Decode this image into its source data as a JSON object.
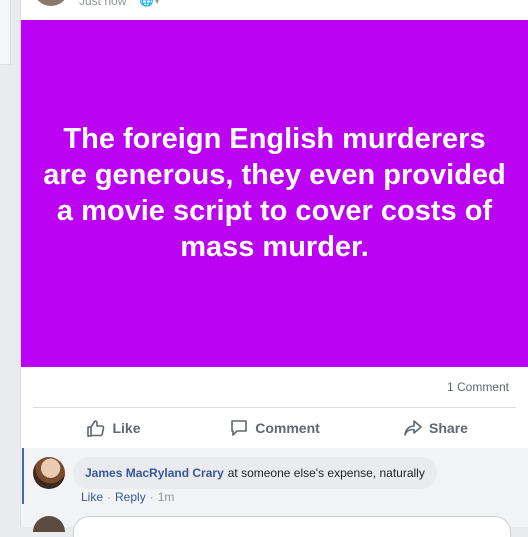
{
  "post": {
    "time": "Just now",
    "privacy_icon": "globe-icon",
    "text": "The foreign English murderers are generous, they even provided a movie script to cover costs of mass murder.",
    "background_color": "#bb02f3"
  },
  "stats": {
    "comments": "1 Comment"
  },
  "actions": {
    "like": "Like",
    "comment": "Comment",
    "share": "Share"
  },
  "comment": {
    "author": "James MacRyland Crary",
    "text": "at someone else's expense, naturally",
    "like": "Like",
    "reply": "Reply",
    "time": "1m"
  }
}
